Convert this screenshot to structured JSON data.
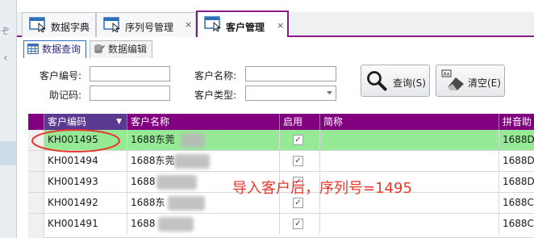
{
  "left_panel": {
    "glyph": "ぞ",
    "chevron": "‹"
  },
  "tabs": [
    {
      "label": "数据字典",
      "icon": "app-window-icon",
      "close": ""
    },
    {
      "label": "序列号管理",
      "icon": "app-window-icon",
      "close": "×"
    },
    {
      "label": "客户管理",
      "icon": "app-window-icon",
      "close": "×",
      "active": true
    }
  ],
  "subtabs": [
    {
      "label": "数据查询",
      "icon": "table-grid-icon",
      "active": true
    },
    {
      "label": "数据编辑",
      "icon": "database-icon"
    }
  ],
  "form": {
    "customer_code_label": "客户编号:",
    "customer_code_value": "",
    "mnemonic_label": "助记码:",
    "mnemonic_value": "",
    "customer_name_label": "客户名称:",
    "customer_name_value": "",
    "customer_type_label": "客户类型:",
    "customer_type_value": "",
    "query_button": "查询(S)",
    "clear_button": "清空(E)"
  },
  "grid": {
    "columns": [
      "客户编码",
      "客户名称",
      "启用",
      "简称",
      "拼音助"
    ],
    "sort_indicator": "▼",
    "rows": [
      {
        "code": "KH001495",
        "name": "1688东莞",
        "enabled": "✓",
        "abbr": "",
        "pinyin": "1688D",
        "selected": true
      },
      {
        "code": "KH001494",
        "name": "1688东莞",
        "enabled": "✓",
        "abbr": "",
        "pinyin": "1688D"
      },
      {
        "code": "KH001493",
        "name": "1688",
        "enabled": "✓",
        "abbr": "",
        "pinyin": "1688D"
      },
      {
        "code": "KH001492",
        "name": "1688东",
        "enabled": "✓",
        "abbr": "",
        "pinyin": "1688C"
      },
      {
        "code": "KH001491",
        "name": "1688",
        "enabled": "✓",
        "abbr": "",
        "pinyin": "1688C"
      }
    ]
  },
  "annotation": {
    "text": "导入客户后，序列号=1495",
    "color": "#e8382c"
  },
  "colors": {
    "accent": "#800080",
    "selected_row": "#96ea96",
    "header_text": "#ffffff"
  }
}
